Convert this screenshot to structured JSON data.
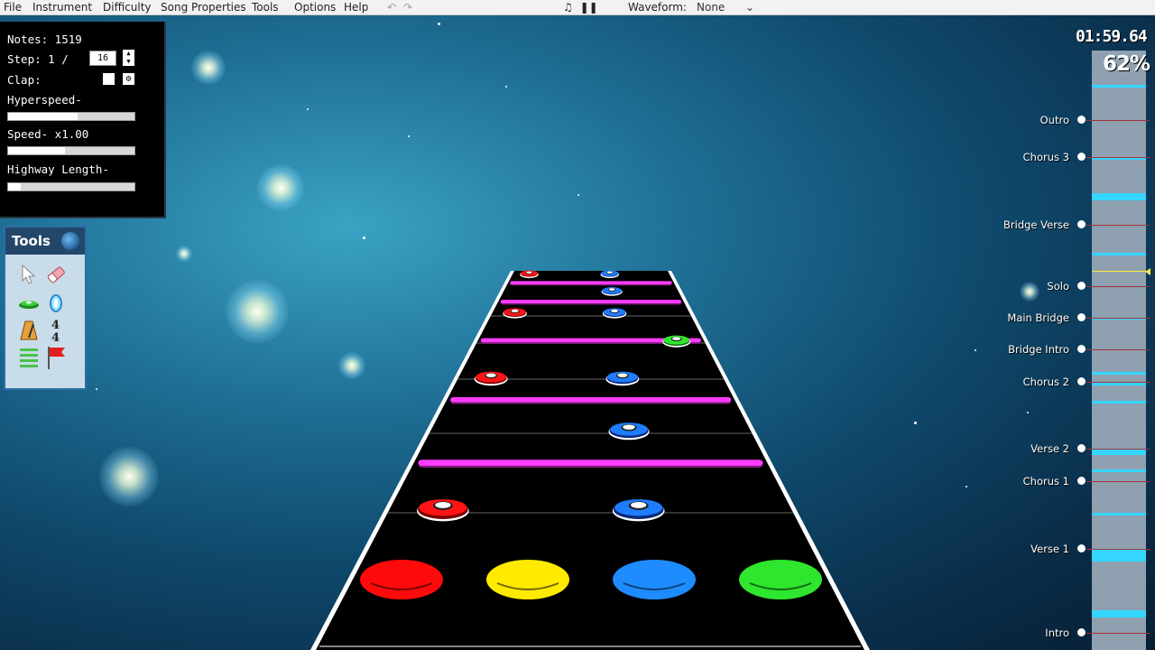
{
  "menu": {
    "items": [
      "File",
      "Instrument",
      "Difficulty",
      "Song Properties",
      "Tools",
      "Options",
      "Help"
    ],
    "undo_icon": "undo-icon",
    "redo_icon": "redo-icon",
    "metronome_icon": "metronome-icon",
    "pause_icon": "pause-icon",
    "waveform_label": "Waveform:",
    "waveform_value": "None"
  },
  "properties": {
    "notes_label": "Notes: 1519",
    "step_label": "Step: 1 /",
    "step_value": "16",
    "clap_label": "Clap:",
    "hyperspeed_label": "Hyperspeed-",
    "speed_label": "Speed- x1.00",
    "highway_length_label": "Highway Length-",
    "hyperspeed_level": 0.55,
    "speed_level": 0.45,
    "highway_length_level": 0.1
  },
  "tools": {
    "title": "Tools",
    "items": [
      "cursor-icon",
      "eraser-icon",
      "note-icon",
      "starpower-icon",
      "bpm-icon",
      "time-signature-icon",
      "section-icon",
      "event-flag-icon"
    ],
    "time_signature": "4/4"
  },
  "timeline": {
    "time": "01:59.64",
    "progress": "62%",
    "sections": [
      {
        "name": "Outro"
      },
      {
        "name": "Chorus 3"
      },
      {
        "name": "Bridge Verse"
      },
      {
        "name": "Solo"
      },
      {
        "name": "Main Bridge"
      },
      {
        "name": "Bridge Intro"
      },
      {
        "name": "Chorus 2"
      },
      {
        "name": "Verse 2"
      },
      {
        "name": "Chorus 1"
      },
      {
        "name": "Verse 1"
      },
      {
        "name": "Intro"
      }
    ]
  },
  "highway": {
    "strikers": [
      {
        "lane": "red",
        "color": "#ff0a0a"
      },
      {
        "lane": "yellow",
        "color": "#ffea00"
      },
      {
        "lane": "blue",
        "color": "#1e8cff"
      },
      {
        "lane": "green",
        "color": "#2ee62e"
      }
    ],
    "starpower_color": "#ff3cff"
  }
}
